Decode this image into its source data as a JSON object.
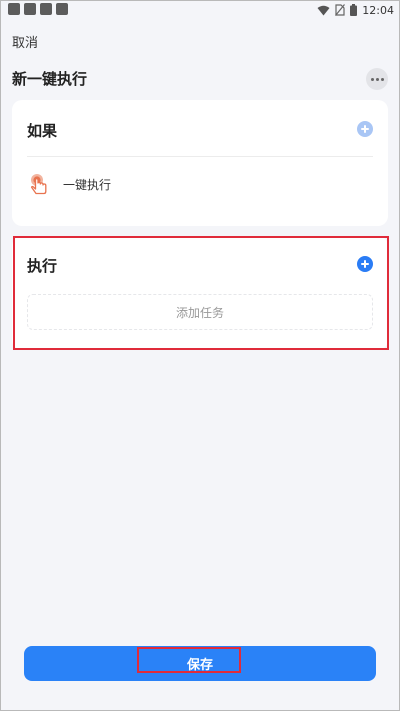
{
  "status_bar": {
    "time": "12:04",
    "left_icons": [
      "app-icon",
      "app-icon",
      "app-icon",
      "app-icon"
    ],
    "right_icons": [
      "wifi-icon",
      "no-sim-icon",
      "battery-icon"
    ]
  },
  "header": {
    "cancel_label": "取消",
    "title": "新一键执行",
    "more_icon": "more-icon"
  },
  "if_card": {
    "title": "如果",
    "trigger_label": "一键执行",
    "trigger_icon": "tap-hand-icon"
  },
  "do_card": {
    "title": "执行",
    "add_task_label": "添加任务"
  },
  "footer": {
    "save_label": "保存"
  },
  "colors": {
    "accent": "#2a82f7",
    "highlight": "#e02b3a",
    "trigger_icon": "#e8734f"
  }
}
